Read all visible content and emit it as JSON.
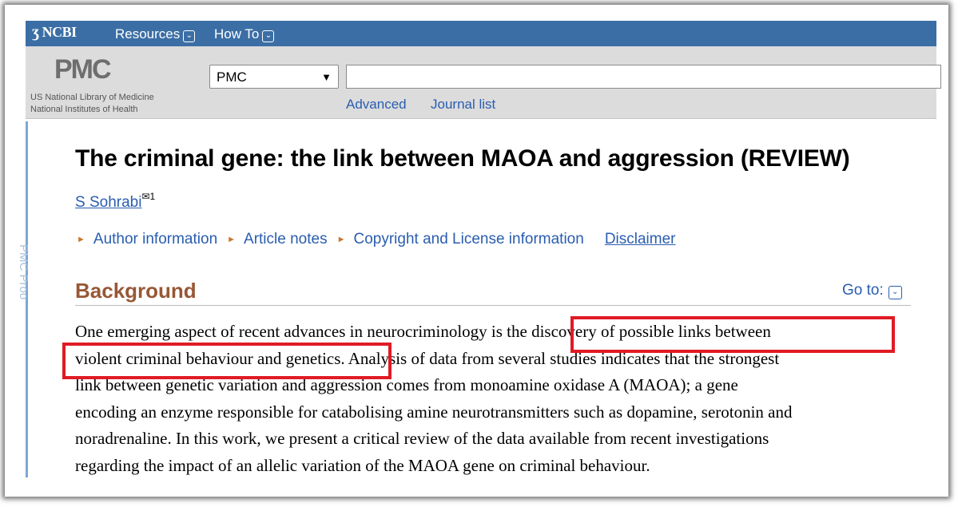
{
  "topbar": {
    "brand": "NCBI",
    "menu": [
      "Resources",
      "How To"
    ]
  },
  "header": {
    "logo": "PMC",
    "org_line1": "US National Library of Medicine",
    "org_line2": "National Institutes of Health",
    "database_select": "PMC",
    "search_value": "",
    "links": [
      "Advanced",
      "Journal list"
    ]
  },
  "side_label": "PMC Proo",
  "article": {
    "title": "The criminal gene: the link between MAOA and aggression (REVIEW)",
    "author": "S Sohrabi",
    "author_affil": "1",
    "info_links": [
      "Author information",
      "Article notes",
      "Copyright and License information"
    ],
    "disclaimer": "Disclaimer"
  },
  "section": {
    "heading": "Background",
    "goto": "Go to:",
    "lines": [
      "One emerging aspect of recent advances in neurocriminology is the discovery of possible links between",
      "violent criminal behaviour and genetics. Analysis of data from several studies indicates that the strongest",
      "link between genetic variation and aggression comes from monoamine oxidase A (MAOA); a gene",
      "encoding an enzyme responsible for catabolising amine neurotransmitters such as dopamine, serotonin and",
      "noradrenaline. In this work, we present a critical review of the data available from recent investigations",
      "regarding the impact of an allelic variation of the MAOA gene on criminal behaviour."
    ]
  },
  "colors": {
    "topbar": "#3b6ea5",
    "link": "#2a5db0",
    "heading": "#985735",
    "highlight": "#e01b24"
  }
}
